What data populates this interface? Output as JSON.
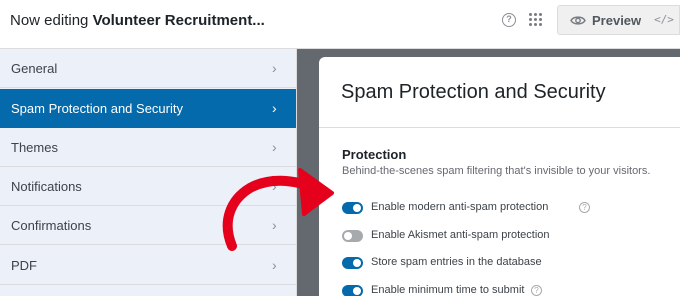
{
  "header": {
    "editing_prefix": "Now editing",
    "form_name": "Volunteer Recruitment...",
    "help_icon": "question-circle-icon",
    "grid_icon": "grid-dots-icon",
    "preview_label": "Preview",
    "code_icon": "</>"
  },
  "sidebar": {
    "items": [
      {
        "label": "General",
        "active": false
      },
      {
        "label": "Spam Protection and Security",
        "active": true
      },
      {
        "label": "Themes",
        "active": false
      },
      {
        "label": "Notifications",
        "active": false
      },
      {
        "label": "Confirmations",
        "active": false
      },
      {
        "label": "PDF",
        "active": false
      }
    ],
    "chevron": "›"
  },
  "main": {
    "title": "Spam Protection and Security",
    "section": {
      "title": "Protection",
      "description": "Behind-the-scenes spam filtering that's invisible to your visitors.",
      "options": [
        {
          "label": "Enable modern anti-spam protection",
          "enabled": true,
          "has_help": true
        },
        {
          "label": "Enable Akismet anti-spam protection",
          "enabled": false,
          "has_help": false
        },
        {
          "label": "Store spam entries in the database",
          "enabled": true,
          "has_help": false
        },
        {
          "label": "Enable minimum time to submit",
          "enabled": true,
          "has_help": true
        }
      ],
      "help_glyph": "?"
    }
  },
  "colors": {
    "accent": "#056aab",
    "sidebar_bg": "#ecf0f8",
    "main_bg": "#646970",
    "annotation_arrow": "#e5001c"
  }
}
